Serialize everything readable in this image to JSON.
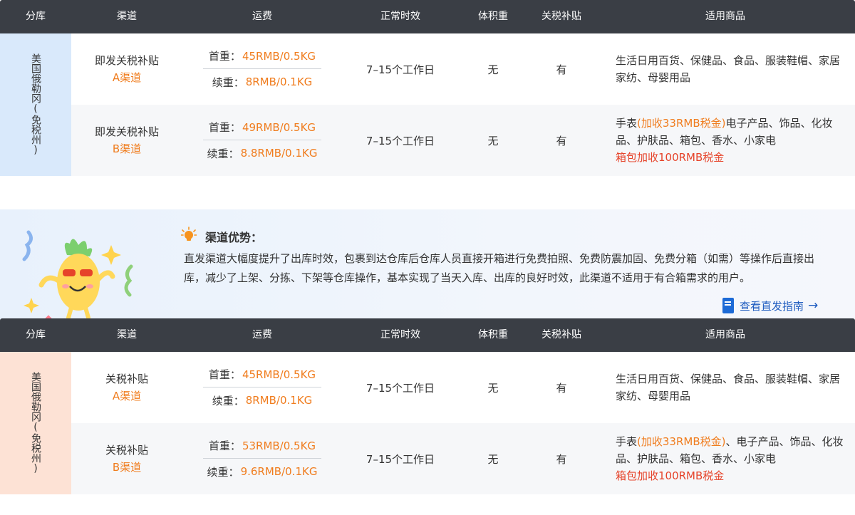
{
  "headers": [
    "分库",
    "渠道",
    "运费",
    "正常时效",
    "体积重",
    "关税补贴",
    "适用商品"
  ],
  "table1": {
    "warehouse": "美国俄勒冈(免税州)",
    "rows": [
      {
        "channel_name": "即发关税补贴",
        "channel_sub": "A渠道",
        "first_label": "首重：",
        "first_value": "45RMB/0.5KG",
        "cont_label": "续重：",
        "cont_value": "8RMB/0.1KG",
        "time": "7–15个工作日",
        "volume": "无",
        "subsidy": "有",
        "goods_a": "生活日用百货、保健品、食品、服装鞋帽、家居家纺、母婴用品"
      },
      {
        "channel_name": "即发关税补贴",
        "channel_sub": "B渠道",
        "first_label": "首重：",
        "first_value": "49RMB/0.5KG",
        "cont_label": "续重：",
        "cont_value": "8.8RMB/0.1KG",
        "time": "7–15个工作日",
        "volume": "无",
        "subsidy": "有",
        "goods_a": "手表",
        "goods_b": "(加收33RMB税金)",
        "goods_c": "电子产品、饰品、化妆品、护肤品、箱包、香水、小家电",
        "goods_d": "箱包加收100RMB税金"
      }
    ],
    "advantage": {
      "title": "渠道优势：",
      "text": "直发渠道大幅度提升了出库时效，包裹到达仓库后仓库人员直接开箱进行免费拍照、免费防震加固、免费分箱（如需）等操作后直接出库，减少了上架、分拣、下架等仓库操作，基本实现了当天入库、出库的良好时效，此渠道不适用于有合箱需求的用户。",
      "link": "查看直发指南"
    }
  },
  "table2": {
    "warehouse": "美国俄勒冈(免税州)",
    "rows": [
      {
        "channel_name": "关税补贴",
        "channel_sub": "A渠道",
        "first_label": "首重：",
        "first_value": "45RMB/0.5KG",
        "cont_label": "续重：",
        "cont_value": "8RMB/0.1KG",
        "time": "7–15个工作日",
        "volume": "无",
        "subsidy": "有",
        "goods_a": "生活日用百货、保健品、食品、服装鞋帽、家居家纺、母婴用品"
      },
      {
        "channel_name": "关税补贴",
        "channel_sub": "B渠道",
        "first_label": "首重：",
        "first_value": "53RMB/0.5KG",
        "cont_label": "续重：",
        "cont_value": "9.6RMB/0.1KG",
        "time": "7–15个工作日",
        "volume": "无",
        "subsidy": "有",
        "goods_a": "手表",
        "goods_b": "(加收33RMB税金)",
        "goods_c": "、电子产品、饰品、化妆品、护肤品、箱包、香水、小家电",
        "goods_d": "箱包加收100RMB税金"
      }
    ]
  },
  "colors": {
    "header_bg": "#3a3e45",
    "accent_orange": "#f07c1d",
    "accent_red": "#e6432a",
    "link_blue": "#1d5bbf"
  }
}
